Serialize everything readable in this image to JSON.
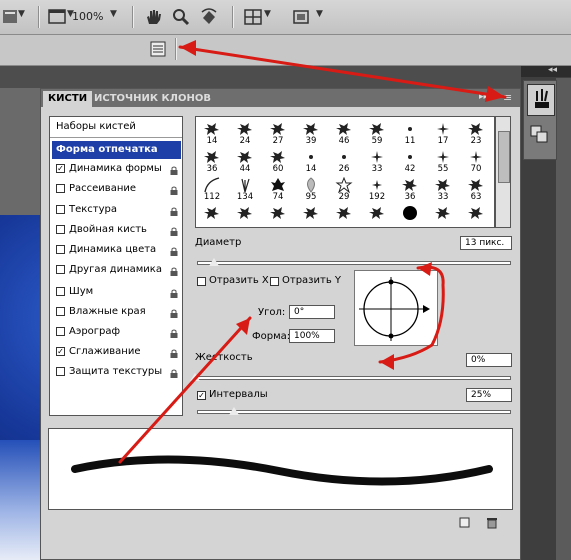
{
  "toolbar": {
    "zoom_value": "100%"
  },
  "panel": {
    "tabs": [
      "КИСТИ",
      "ИСТОЧНИК КЛОНОВ"
    ],
    "presets_label": "Наборы кистей",
    "items": [
      {
        "label": "Форма отпечатка кисти",
        "checked": null,
        "selected": true,
        "lock": false
      },
      {
        "label": "Динамика формы",
        "checked": true,
        "lock": true
      },
      {
        "label": "Рассеивание",
        "checked": false,
        "lock": true
      },
      {
        "label": "Текстура",
        "checked": false,
        "lock": true
      },
      {
        "label": "Двойная кисть",
        "checked": false,
        "lock": true
      },
      {
        "label": "Динамика цвета",
        "checked": false,
        "lock": true
      },
      {
        "label": "Другая динамика",
        "checked": false,
        "lock": true
      },
      {
        "label": "Шум",
        "checked": false,
        "lock": true
      },
      {
        "label": "Влажные края",
        "checked": false,
        "lock": true
      },
      {
        "label": "Аэрограф",
        "checked": false,
        "lock": true
      },
      {
        "label": "Сглаживание",
        "checked": true,
        "lock": true
      },
      {
        "label": "Защита текстуры",
        "checked": false,
        "lock": true
      }
    ],
    "brush_sizes": [
      "14",
      "24",
      "27",
      "39",
      "46",
      "59",
      "11",
      "17",
      "23",
      "36",
      "44",
      "60",
      "14",
      "26",
      "33",
      "42",
      "55",
      "70",
      "112",
      "134",
      "74",
      "95",
      "29",
      "192",
      "36",
      "33",
      "63",
      "",
      "",
      "",
      "",
      "",
      "",
      "",
      "",
      ""
    ],
    "diameter_label": "Диаметр",
    "diameter_value": "13 пикс.",
    "flip_x_label": "Отразить X",
    "flip_y_label": "Отразить Y",
    "angle_label": "Угол:",
    "angle_value": "0°",
    "roundness_label": "Форма:",
    "roundness_value": "100%",
    "hardness_label": "Жесткость",
    "hardness_value": "0%",
    "spacing_label": "Интервалы",
    "spacing_value": "25%",
    "spacing_checked": true
  },
  "colors": {
    "arrow": "#d81b14",
    "selected_item_bg": "#1f3fa8"
  }
}
